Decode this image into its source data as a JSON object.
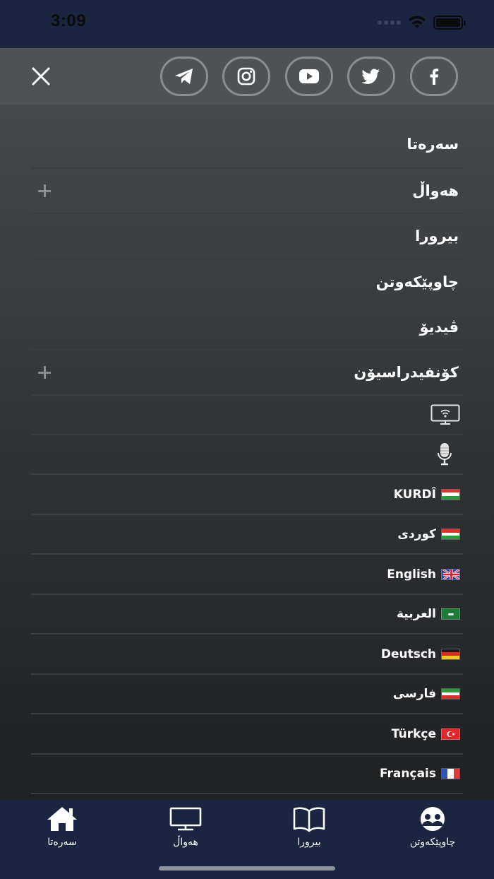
{
  "status_bar": {
    "time": "3:09"
  },
  "header": {
    "social": [
      {
        "icon": "telegram-icon"
      },
      {
        "icon": "instagram-icon"
      },
      {
        "icon": "youtube-icon"
      },
      {
        "icon": "twitter-icon"
      },
      {
        "icon": "facebook-icon"
      }
    ]
  },
  "menu": {
    "items": [
      {
        "label": "سەرەتا",
        "expandable": false
      },
      {
        "label": "هەواڵ",
        "expandable": true
      },
      {
        "label": "بیرورا",
        "expandable": false
      },
      {
        "label": "چاوپێکەوتن",
        "expandable": false
      },
      {
        "label": "ڤیدیۆ",
        "expandable": false
      },
      {
        "label": "کۆنفیدراسیۆن",
        "expandable": true
      }
    ],
    "live_tv_icon": "live-tv-icon",
    "radio_icon": "microphone-icon"
  },
  "languages": [
    {
      "label": "KURDÎ",
      "flag": "kurdistan"
    },
    {
      "label": "کوردی",
      "flag": "kurdistan"
    },
    {
      "label": "English",
      "flag": "uk"
    },
    {
      "label": "العربية",
      "flag": "saudi"
    },
    {
      "label": "Deutsch",
      "flag": "germany"
    },
    {
      "label": "فارسی",
      "flag": "iran"
    },
    {
      "label": "Türkçe",
      "flag": "turkey"
    },
    {
      "label": "Français",
      "flag": "france"
    }
  ],
  "tabs": [
    {
      "label": "سەرەتا",
      "icon": "home-icon"
    },
    {
      "label": "هەواڵ",
      "icon": "tv-icon"
    },
    {
      "label": "بیرورا",
      "icon": "book-icon"
    },
    {
      "label": "چاوپێکەوتن",
      "icon": "interview-icon"
    }
  ],
  "colors": {
    "status_bar": "#1b2440",
    "header": "#4f5255",
    "tab_bar": "#1b2440",
    "divider": "#3b3e41"
  }
}
